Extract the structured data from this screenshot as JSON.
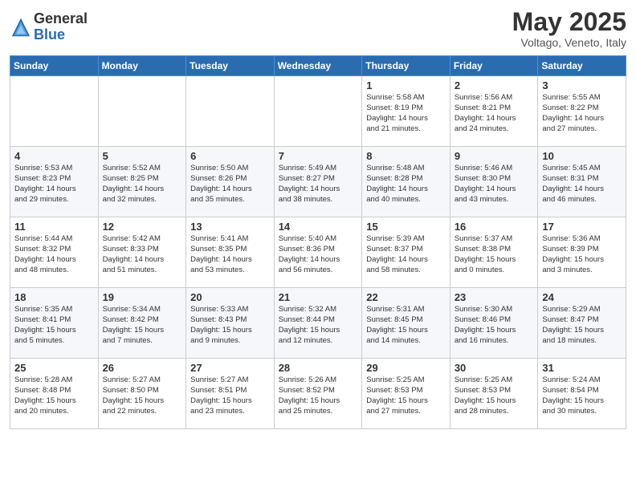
{
  "header": {
    "logo_general": "General",
    "logo_blue": "Blue",
    "month_title": "May 2025",
    "location": "Voltago, Veneto, Italy"
  },
  "weekdays": [
    "Sunday",
    "Monday",
    "Tuesday",
    "Wednesday",
    "Thursday",
    "Friday",
    "Saturday"
  ],
  "rows": [
    [
      {
        "day": "",
        "content": ""
      },
      {
        "day": "",
        "content": ""
      },
      {
        "day": "",
        "content": ""
      },
      {
        "day": "",
        "content": ""
      },
      {
        "day": "1",
        "content": "Sunrise: 5:58 AM\nSunset: 8:19 PM\nDaylight: 14 hours\nand 21 minutes."
      },
      {
        "day": "2",
        "content": "Sunrise: 5:56 AM\nSunset: 8:21 PM\nDaylight: 14 hours\nand 24 minutes."
      },
      {
        "day": "3",
        "content": "Sunrise: 5:55 AM\nSunset: 8:22 PM\nDaylight: 14 hours\nand 27 minutes."
      }
    ],
    [
      {
        "day": "4",
        "content": "Sunrise: 5:53 AM\nSunset: 8:23 PM\nDaylight: 14 hours\nand 29 minutes."
      },
      {
        "day": "5",
        "content": "Sunrise: 5:52 AM\nSunset: 8:25 PM\nDaylight: 14 hours\nand 32 minutes."
      },
      {
        "day": "6",
        "content": "Sunrise: 5:50 AM\nSunset: 8:26 PM\nDaylight: 14 hours\nand 35 minutes."
      },
      {
        "day": "7",
        "content": "Sunrise: 5:49 AM\nSunset: 8:27 PM\nDaylight: 14 hours\nand 38 minutes."
      },
      {
        "day": "8",
        "content": "Sunrise: 5:48 AM\nSunset: 8:28 PM\nDaylight: 14 hours\nand 40 minutes."
      },
      {
        "day": "9",
        "content": "Sunrise: 5:46 AM\nSunset: 8:30 PM\nDaylight: 14 hours\nand 43 minutes."
      },
      {
        "day": "10",
        "content": "Sunrise: 5:45 AM\nSunset: 8:31 PM\nDaylight: 14 hours\nand 46 minutes."
      }
    ],
    [
      {
        "day": "11",
        "content": "Sunrise: 5:44 AM\nSunset: 8:32 PM\nDaylight: 14 hours\nand 48 minutes."
      },
      {
        "day": "12",
        "content": "Sunrise: 5:42 AM\nSunset: 8:33 PM\nDaylight: 14 hours\nand 51 minutes."
      },
      {
        "day": "13",
        "content": "Sunrise: 5:41 AM\nSunset: 8:35 PM\nDaylight: 14 hours\nand 53 minutes."
      },
      {
        "day": "14",
        "content": "Sunrise: 5:40 AM\nSunset: 8:36 PM\nDaylight: 14 hours\nand 56 minutes."
      },
      {
        "day": "15",
        "content": "Sunrise: 5:39 AM\nSunset: 8:37 PM\nDaylight: 14 hours\nand 58 minutes."
      },
      {
        "day": "16",
        "content": "Sunrise: 5:37 AM\nSunset: 8:38 PM\nDaylight: 15 hours\nand 0 minutes."
      },
      {
        "day": "17",
        "content": "Sunrise: 5:36 AM\nSunset: 8:39 PM\nDaylight: 15 hours\nand 3 minutes."
      }
    ],
    [
      {
        "day": "18",
        "content": "Sunrise: 5:35 AM\nSunset: 8:41 PM\nDaylight: 15 hours\nand 5 minutes."
      },
      {
        "day": "19",
        "content": "Sunrise: 5:34 AM\nSunset: 8:42 PM\nDaylight: 15 hours\nand 7 minutes."
      },
      {
        "day": "20",
        "content": "Sunrise: 5:33 AM\nSunset: 8:43 PM\nDaylight: 15 hours\nand 9 minutes."
      },
      {
        "day": "21",
        "content": "Sunrise: 5:32 AM\nSunset: 8:44 PM\nDaylight: 15 hours\nand 12 minutes."
      },
      {
        "day": "22",
        "content": "Sunrise: 5:31 AM\nSunset: 8:45 PM\nDaylight: 15 hours\nand 14 minutes."
      },
      {
        "day": "23",
        "content": "Sunrise: 5:30 AM\nSunset: 8:46 PM\nDaylight: 15 hours\nand 16 minutes."
      },
      {
        "day": "24",
        "content": "Sunrise: 5:29 AM\nSunset: 8:47 PM\nDaylight: 15 hours\nand 18 minutes."
      }
    ],
    [
      {
        "day": "25",
        "content": "Sunrise: 5:28 AM\nSunset: 8:48 PM\nDaylight: 15 hours\nand 20 minutes."
      },
      {
        "day": "26",
        "content": "Sunrise: 5:27 AM\nSunset: 8:50 PM\nDaylight: 15 hours\nand 22 minutes."
      },
      {
        "day": "27",
        "content": "Sunrise: 5:27 AM\nSunset: 8:51 PM\nDaylight: 15 hours\nand 23 minutes."
      },
      {
        "day": "28",
        "content": "Sunrise: 5:26 AM\nSunset: 8:52 PM\nDaylight: 15 hours\nand 25 minutes."
      },
      {
        "day": "29",
        "content": "Sunrise: 5:25 AM\nSunset: 8:53 PM\nDaylight: 15 hours\nand 27 minutes."
      },
      {
        "day": "30",
        "content": "Sunrise: 5:25 AM\nSunset: 8:53 PM\nDaylight: 15 hours\nand 28 minutes."
      },
      {
        "day": "31",
        "content": "Sunrise: 5:24 AM\nSunset: 8:54 PM\nDaylight: 15 hours\nand 30 minutes."
      }
    ]
  ]
}
